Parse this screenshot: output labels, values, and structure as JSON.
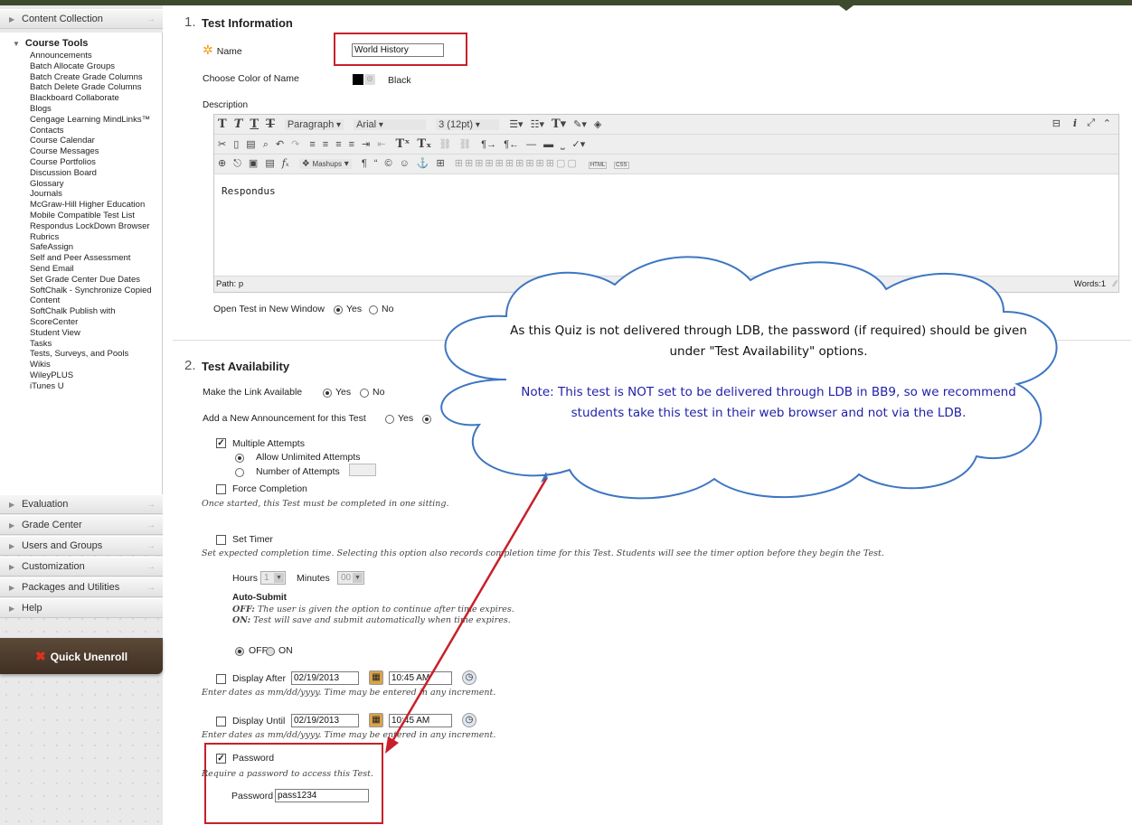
{
  "sidebar": {
    "content_collection": "Content Collection",
    "course_tools_title": "Course Tools",
    "course_tools": [
      "Announcements",
      "Batch Allocate Groups",
      "Batch Create Grade Columns",
      "Batch Delete Grade Columns",
      "Blackboard Collaborate",
      "Blogs",
      "Cengage Learning MindLinks™",
      "Contacts",
      "Course Calendar",
      "Course Messages",
      "Course Portfolios",
      "Discussion Board",
      "Glossary",
      "Journals",
      "McGraw-Hill Higher Education",
      "Mobile Compatible Test List",
      "Respondus LockDown Browser",
      "Rubrics",
      "SafeAssign",
      "Self and Peer Assessment",
      "Send Email",
      "Set Grade Center Due Dates",
      "SoftChalk - Synchronize Copied Content",
      "SoftChalk Publish with ScoreCenter",
      "Student View",
      "Tasks",
      "Tests, Surveys, and Pools",
      "Wikis",
      "WileyPLUS",
      "iTunes U"
    ],
    "sections": [
      "Evaluation",
      "Grade Center",
      "Users and Groups",
      "Customization",
      "Packages and Utilities",
      "Help"
    ],
    "quick_unenroll": "Quick Unenroll"
  },
  "section1": {
    "number": "1.",
    "title": "Test Information",
    "name_label": "Name",
    "name_value": "World History",
    "color_label": "Choose Color of Name",
    "color_value": "Black",
    "description_label": "Description",
    "toolbar": {
      "paragraph": "Paragraph",
      "font": "Arial",
      "size": "3 (12pt)",
      "mashups": "Mashups",
      "html": "HTML",
      "css": "CSS"
    },
    "editor_text": "Respondus",
    "path_label": "Path: p",
    "words": "Words:1",
    "open_window_label": "Open Test in New Window",
    "yes": "Yes",
    "no": "No"
  },
  "section2": {
    "number": "2.",
    "title": "Test Availability",
    "make_link_label": "Make the Link Available",
    "announcement_label": "Add a New Announcement for this Test",
    "yes": "Yes",
    "no": "No",
    "multiple_attempts": "Multiple Attempts",
    "allow_unlimited": "Allow Unlimited Attempts",
    "number_of_attempts": "Number of Attempts",
    "force_completion": "Force Completion",
    "force_hint": "Once started, this Test must be completed in one sitting.",
    "set_timer": "Set Timer",
    "timer_hint": "Set expected completion time. Selecting this option also records completion time for this Test. Students will see the timer option before they begin the Test.",
    "hours_label": "Hours",
    "hours_value": "1",
    "minutes_label": "Minutes",
    "minutes_value": "00",
    "auto_submit": "Auto-Submit",
    "off_key": "OFF:",
    "off_hint": "The user is given the option to continue after time expires.",
    "on_key": "ON:",
    "on_hint": "Test will save and submit automatically when time expires.",
    "off": "OFF",
    "on": "ON",
    "display_after": "Display After",
    "after_date": "02/19/2013",
    "after_time": "10:45 AM",
    "date_hint": "Enter dates as mm/dd/yyyy. Time may be entered in any increment.",
    "display_until": "Display Until",
    "until_date": "02/19/2013",
    "until_time": "10:45 AM",
    "password_cb": "Password",
    "password_hint": "Require a password to access this Test.",
    "password_label": "Password",
    "password_value": "pass1234"
  },
  "callout": {
    "line1": "As this Quiz is not delivered through LDB, the password (if required) should be given under \"Test Availability\" options.",
    "line2": "Note: This test is NOT set to be delivered through LDB in BB9, so we recommend students take this test in their web browser and not via the LDB."
  },
  "colors": {
    "accent_red": "#c8202a",
    "note_blue": "#1f1fa8",
    "topbar": "#3e4a2e",
    "unenroll_bg": "#4d3b2c"
  }
}
